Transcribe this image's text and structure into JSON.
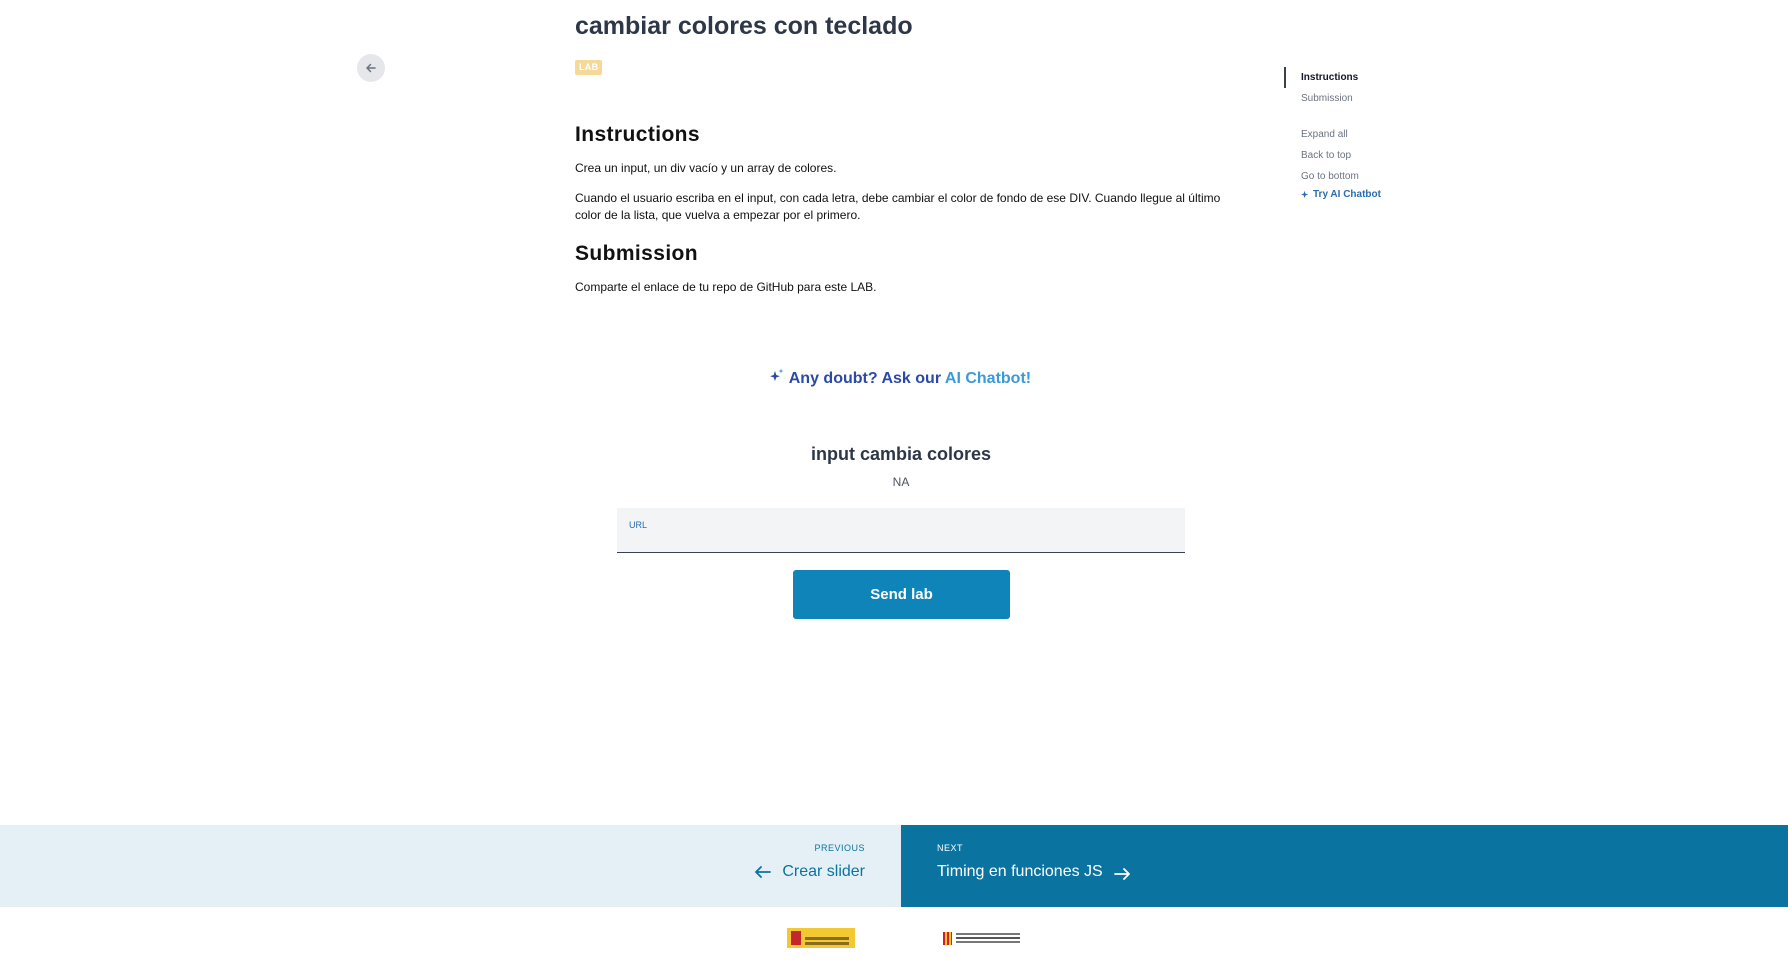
{
  "header": {
    "title": "cambiar colores con teclado",
    "badge": "LAB"
  },
  "content": {
    "instructions_heading": "Instructions",
    "instructions_p1": "Crea un input, un div vacío y un array de colores.",
    "instructions_p2": "Cuando el usuario escriba en el input, con cada letra, debe cambiar el color de fondo de ese DIV. Cuando llegue al último color de la lista, que vuelva a empezar por el primero.",
    "submission_heading": "Submission",
    "submission_p1": "Comparte el enlace de tu repo de GitHub para este LAB."
  },
  "toc": {
    "items": [
      "Instructions",
      "Submission"
    ],
    "active": "Instructions",
    "actions": [
      "Expand all",
      "Back to top",
      "Go to bottom"
    ],
    "ai_link": "Try AI Chatbot"
  },
  "chatbot": {
    "prefix": "Any doubt? Ask our ",
    "link": "AI Chatbot!"
  },
  "submission_form": {
    "title": "input cambia colores",
    "subtitle": "NA",
    "url_label": "URL",
    "url_value": "",
    "button": "Send lab"
  },
  "navigation": {
    "previous_label": "PREVIOUS",
    "previous_title": "Crear slider",
    "next_label": "NEXT",
    "next_title": "Timing en funciones JS"
  },
  "footer": {
    "logos": [
      "spain-government-logo",
      "generalitat-catalunya-logo"
    ]
  },
  "colors": {
    "accent": "#0e84b8",
    "next_bg": "#0b73a0",
    "prev_bg": "#e4f0f6",
    "badge": "#f6d998",
    "chat_link": "#3b9ad9"
  }
}
